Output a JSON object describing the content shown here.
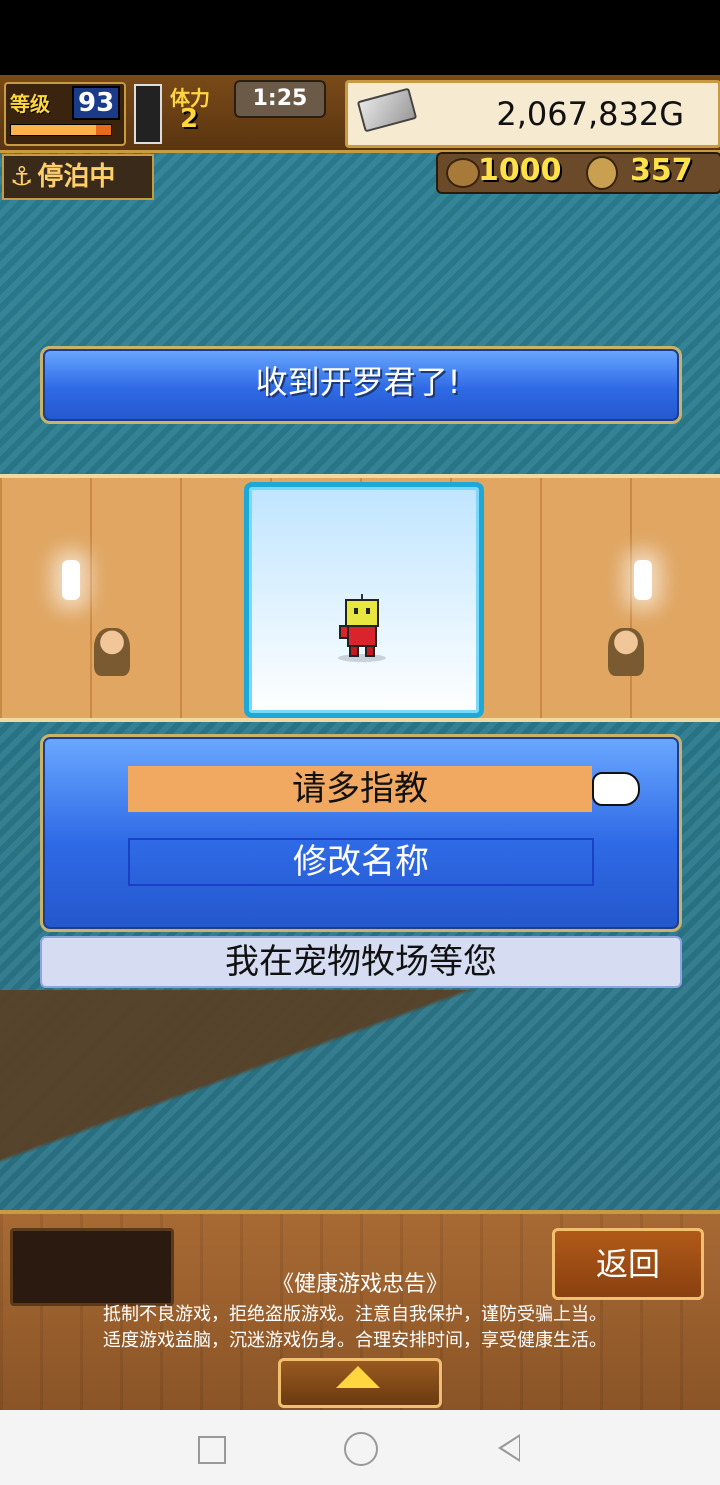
{
  "hud": {
    "level_label": "等级",
    "level_value": "93",
    "level_progress": 0.85,
    "stamina_label": "体力",
    "stamina_value": "2",
    "timer": "1:25",
    "money": "2,067,832G",
    "port_status": "停泊中",
    "resource_1": "1000",
    "resource_2": "357"
  },
  "message": "收到开罗君了!",
  "pet": {
    "name": "开罗君"
  },
  "dialog": {
    "options": [
      "请多指教",
      "修改名称"
    ],
    "selected_index": 0,
    "farm_notice": "我在宠物牧场等您"
  },
  "bottom": {
    "back_label": "返回",
    "notice_title": "《健康游戏忠告》",
    "notice_line1": "抵制不良游戏，拒绝盗版游戏。注意自我保护，谨防受骗上当。",
    "notice_line2": "适度游戏益脑，沉迷游戏伤身。合理安排时间，享受健康生活。"
  },
  "icons": {
    "anchor": "anchor-icon",
    "silver": "silver-bar-icon",
    "pointer": "pointing-hand-icon"
  },
  "colors": {
    "selected_option": "#f1a861",
    "panel_blue": "#2f6ae6",
    "gold_text": "#ffe14a"
  }
}
